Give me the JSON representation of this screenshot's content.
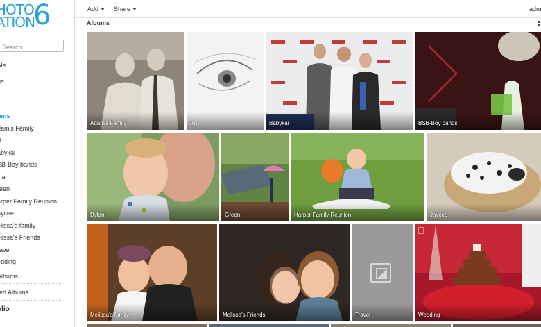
{
  "logo": {
    "line1": "HOTO",
    "line2": "ATION",
    "digit": "6"
  },
  "search": {
    "placeholder": "Search"
  },
  "sidebar": {
    "items": [
      {
        "label": "Me"
      },
      {
        "label": "gs"
      },
      {
        "label": ""
      },
      {
        "label": "ums"
      },
      {
        "label": "dam's Family"
      },
      {
        "label": "rt"
      },
      {
        "label": "abykai"
      },
      {
        "label": "SB-Boy bands"
      },
      {
        "label": "ylan"
      },
      {
        "label": "reen"
      },
      {
        "label": "arper Family Reunion"
      },
      {
        "label": "aycee"
      },
      {
        "label": "elissa's family"
      },
      {
        "label": "elissa's Friends"
      },
      {
        "label": "ravel"
      },
      {
        "label": "edding"
      },
      {
        "label": "Albums"
      },
      {
        "label": "red Albums"
      },
      {
        "label": "olio"
      }
    ]
  },
  "topbar": {
    "add_label": "Add",
    "share_label": "Share",
    "user": "adm"
  },
  "section_title": "Albums",
  "albums": [
    {
      "name": "Adam's Family"
    },
    {
      "name": "Art"
    },
    {
      "name": "Babykai"
    },
    {
      "name": "BSB-Boy bands"
    },
    {
      "name": "Dylan"
    },
    {
      "name": "Green"
    },
    {
      "name": "Harper Family Reunion"
    },
    {
      "name": "Jaycee"
    },
    {
      "name": "Melissa's family"
    },
    {
      "name": "Melissa's Friends"
    },
    {
      "name": "Travel"
    },
    {
      "name": "Wedding"
    }
  ],
  "colors": {
    "accent": "#1a9ad6",
    "logo": "#2aa3d8"
  }
}
